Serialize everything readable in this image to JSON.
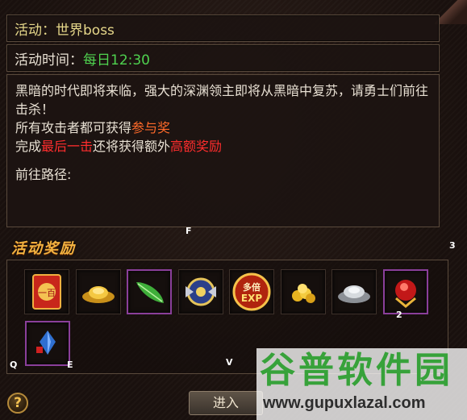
{
  "activity": {
    "title": "活动：世界boss",
    "time_label": "活动时间：",
    "time_value": "每日12:30"
  },
  "description": {
    "line1": "黑暗的时代即将来临，强大的深渊领主即将从黑暗中复苏，请勇士们前往击杀！",
    "line2_prefix": "所有攻击者都可获得",
    "line2_highlight": "参与奖",
    "line3_prefix": "完成",
    "line3_highlight1": "最后一击",
    "line3_middle": "还将获得额外",
    "line3_highlight2": "高额奖励",
    "path_label": "前往路径:"
  },
  "rewards": {
    "title": "活动奖励",
    "items": [
      {
        "icon": "red-envelope-icon",
        "text": "一百"
      },
      {
        "icon": "gold-ingot-icon"
      },
      {
        "icon": "green-feather-icon"
      },
      {
        "icon": "winged-emblem-icon"
      },
      {
        "icon": "multi-exp-icon",
        "text_top": "多倍",
        "text_bottom": "EXP"
      },
      {
        "icon": "gold-coins-icon"
      },
      {
        "icon": "silver-ingot-icon"
      },
      {
        "icon": "red-gem-icon"
      },
      {
        "icon": "blue-crystal-icon"
      }
    ]
  },
  "markers": {
    "f": "F",
    "three": "3",
    "two": "2",
    "q": "Q",
    "e": "E",
    "v": "V"
  },
  "buttons": {
    "help": "?",
    "enter": "进入"
  },
  "watermark": {
    "logo": "谷普软件园",
    "url": "www.gupuxlazal.com"
  },
  "colors": {
    "title": "#e6d78a",
    "time": "#4fd24f",
    "highlight_orange": "#ff6a2a",
    "highlight_red": "#ff2d2d",
    "reward_title": "#f2b341",
    "rare_border": "#8a3f9a"
  }
}
